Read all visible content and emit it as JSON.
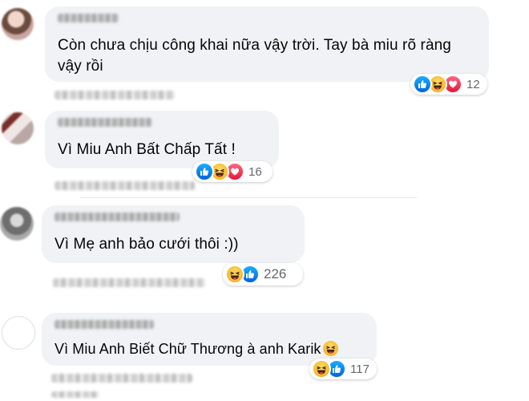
{
  "comments": [
    {
      "text_line1": "Còn chưa chịu công khai nữa vậy trời. Tay bà miu rõ ràng",
      "text_line2": "vậy rồi",
      "reaction_count": "12",
      "reactions": [
        "like-icon",
        "haha-icon",
        "love-icon"
      ]
    },
    {
      "text": "Vì Miu Anh Bất Chấp Tất !",
      "reaction_count": "16",
      "reactions": [
        "like-icon",
        "haha-icon",
        "love-icon"
      ]
    },
    {
      "text": "Vì Mẹ anh bảo cưới thôi :))",
      "reaction_count": "226",
      "reactions": [
        "haha-icon",
        "like-icon"
      ]
    },
    {
      "text": "Vì Miu Anh Biết Chữ Thương à anh Karik",
      "trailing_emoji": "laughing-emoji-icon",
      "reaction_count": "117",
      "reactions": [
        "haha-icon",
        "like-icon"
      ]
    }
  ],
  "colors": {
    "bubble_bg": "#f0f2f5",
    "text": "#050505",
    "secondary_text": "#65676b",
    "like_blue": "#0062df",
    "love_red": "#e61739",
    "haha_yellow": "#f7b125"
  }
}
